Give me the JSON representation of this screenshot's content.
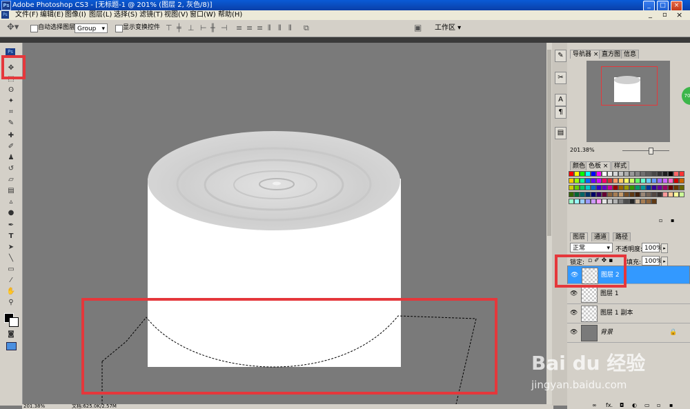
{
  "window": {
    "title": "Adobe Photoshop CS3 - [无标题-1 @ 201% (图层 2, 灰色/8)]",
    "app_icon": "Ps",
    "min": "_",
    "max": "□",
    "close": "×"
  },
  "menu": [
    "文件(F)",
    "编辑(E)",
    "图像(I)",
    "图层(L)",
    "选择(S)",
    "滤镜(T)",
    "视图(V)",
    "窗口(W)",
    "帮助(H)"
  ],
  "options": {
    "auto_select_label": "自动选择图层",
    "group_value": "Group",
    "show_transform_label": "显示变换控件",
    "workspace_label": "工作区 ▾"
  },
  "navigator": {
    "tabs": [
      "导航器 ×",
      "直方图",
      "信息"
    ],
    "zoom": "201.38%"
  },
  "swatches": {
    "tabs": [
      "颜色",
      "色板 ×",
      "样式"
    ],
    "colors": [
      "#ff0000",
      "#ffff00",
      "#00ff00",
      "#00ffff",
      "#0000ff",
      "#ff00ff",
      "#ffffff",
      "#ebebeb",
      "#d6d6d6",
      "#c2c2c2",
      "#adadad",
      "#999999",
      "#858585",
      "#707070",
      "#5c5c5c",
      "#474747",
      "#333333",
      "#1f1f1f",
      "#000000",
      "#ff6666",
      "#ff3333",
      "#ffcc00",
      "#99ff00",
      "#00ff99",
      "#0066ff",
      "#6600ff",
      "#cc00ff",
      "#ff0066",
      "#cc3333",
      "#ff9966",
      "#ffcc66",
      "#ffff66",
      "#ccff66",
      "#66ff66",
      "#66ffcc",
      "#66ccff",
      "#6699ff",
      "#9966ff",
      "#cc66ff",
      "#ff66cc",
      "#cc0000",
      "#cc6600",
      "#cccc00",
      "#66cc00",
      "#00cc66",
      "#00cccc",
      "#0066cc",
      "#3300cc",
      "#6600cc",
      "#cc0099",
      "#990000",
      "#996600",
      "#999900",
      "#339900",
      "#009966",
      "#009999",
      "#003399",
      "#330099",
      "#660099",
      "#990066",
      "#660000",
      "#663300",
      "#666600",
      "#336600",
      "#006633",
      "#006666",
      "#003366",
      "#000066",
      "#330066",
      "#660033",
      "#8c6239",
      "#a67c52",
      "#c69c6d",
      "#754c24",
      "#603913",
      "#42210b",
      "#998675",
      "#736357",
      "#534741",
      "#362f2d",
      "#ff9999",
      "#ffcc99",
      "#ffff99",
      "#ccff99",
      "#99ffcc",
      "#99ffff",
      "#99ccff",
      "#9999ff",
      "#cc99ff",
      "#ff99ff",
      "#e6e6e6",
      "#cccccc",
      "#b3b3b3",
      "#808080",
      "#4d4d4d",
      "#262626",
      "#c7b299",
      "#a67c52",
      "#8c6239",
      "#603913"
    ]
  },
  "layers": {
    "tabs": [
      "图层",
      "通道",
      "路径"
    ],
    "blend_mode": "正常",
    "opacity_label": "不透明度:",
    "opacity_value": "100%",
    "lock_label": "锁定:",
    "fill_label": "填充:",
    "fill_value": "100%",
    "items": [
      {
        "name": "图层 2",
        "selected": true
      },
      {
        "name": "图层 1",
        "selected": false
      },
      {
        "name": "图层 1 副本",
        "selected": false
      },
      {
        "name": "背景",
        "selected": false
      }
    ]
  },
  "status": {
    "zoom": "201.38%",
    "doc": "文档:625.0K/2.57M"
  },
  "watermark": {
    "brand": "Bai du 经验",
    "url": "jingyan.baidu.com"
  },
  "colors": {
    "canvas_bg": "#7a7a7a",
    "selection_highlight": "#3399ff",
    "annotation_red": "#e5373b"
  }
}
